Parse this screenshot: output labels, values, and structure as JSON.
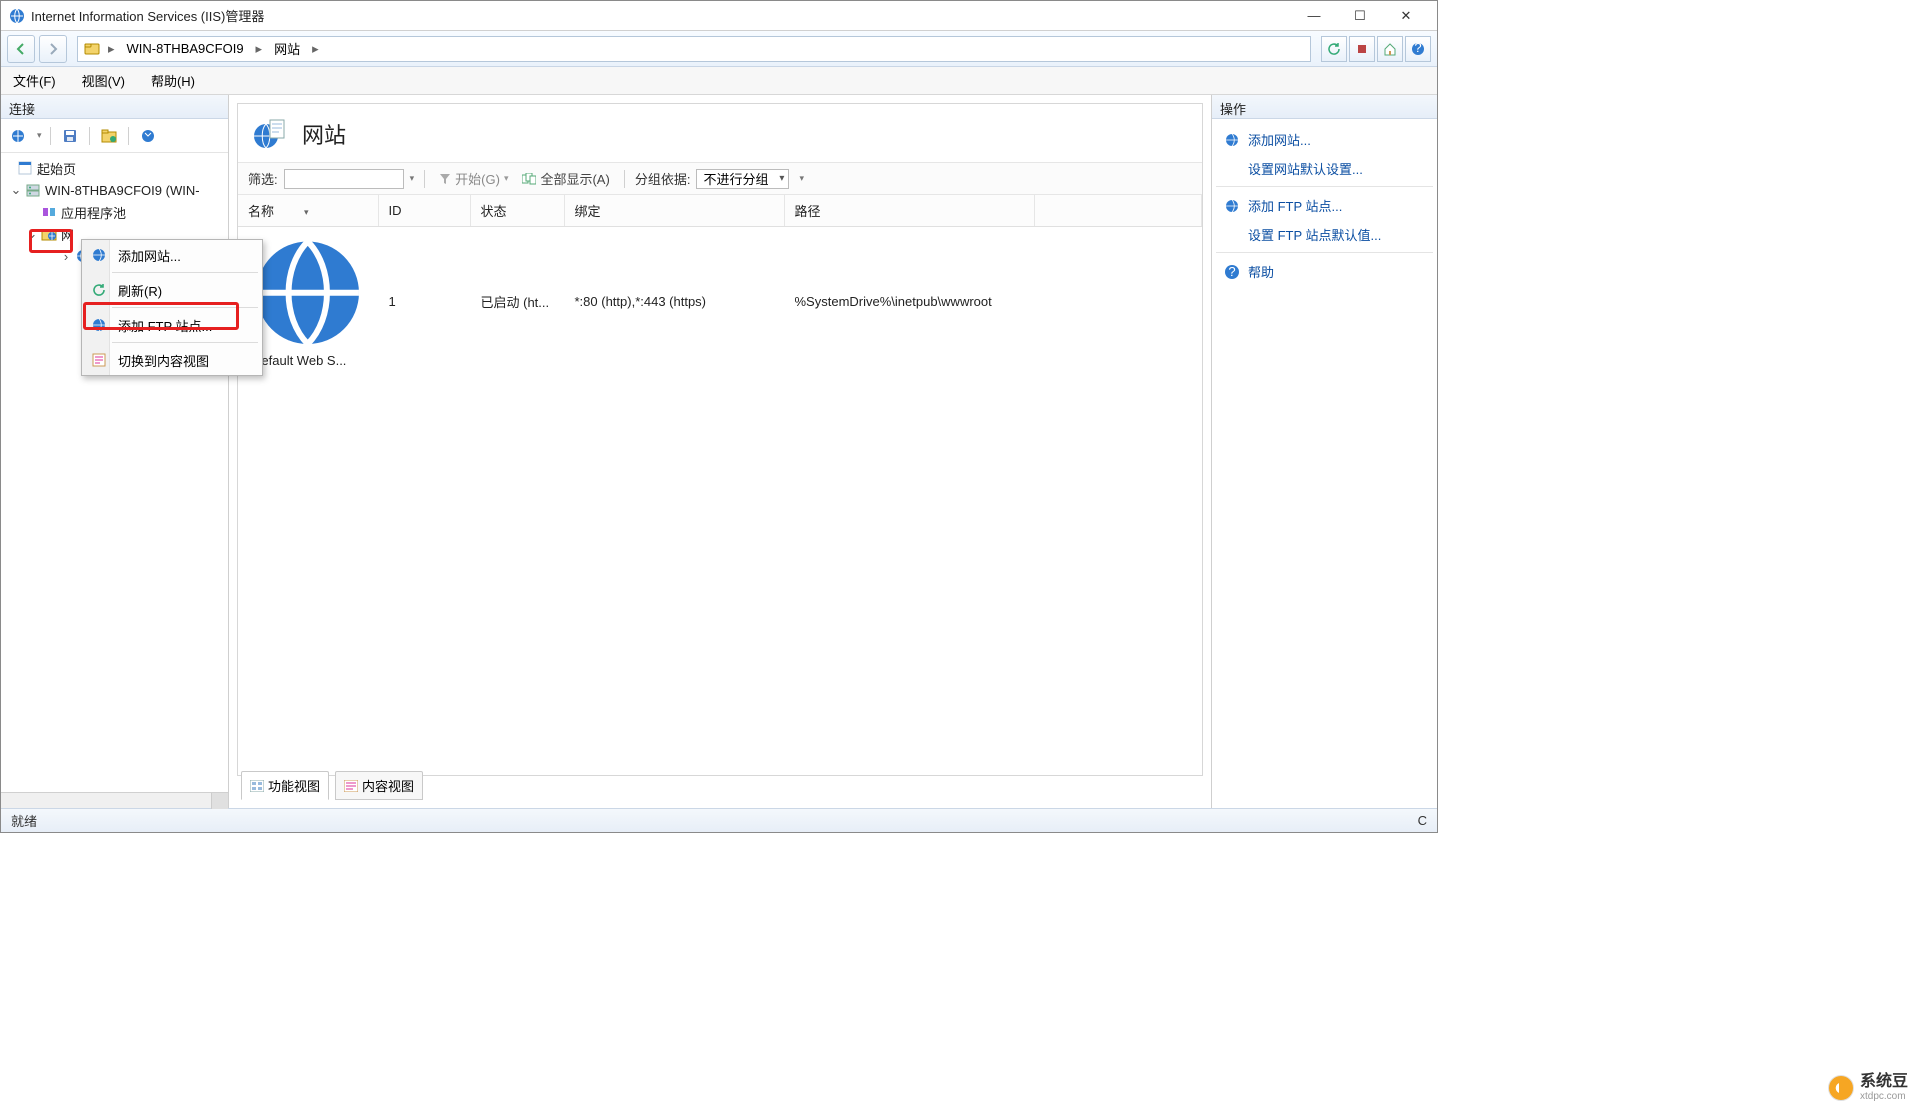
{
  "window": {
    "title": "Internet Information Services (IIS)管理器",
    "minimize": "—",
    "maximize": "☐",
    "close": "✕"
  },
  "breadcrumb": {
    "server": "WIN-8THBA9CFOI9",
    "node": "网站"
  },
  "menu": {
    "file": "文件(F)",
    "view": "视图(V)",
    "help": "帮助(H)"
  },
  "connections": {
    "header": "连接",
    "start_page": "起始页",
    "server": "WIN-8THBA9CFOI9 (WIN-",
    "app_pools": "应用程序池",
    "sites": "网"
  },
  "context_menu": {
    "add_site": "添加网站...",
    "refresh": "刷新(R)",
    "add_ftp": "添加 FTP 站点...",
    "content_view": "切换到内容视图"
  },
  "page": {
    "title": "网站"
  },
  "filter": {
    "label": "筛选:",
    "start": "开始(G)",
    "show_all": "全部显示(A)",
    "group_by": "分组依据:",
    "group_selected": "不进行分组"
  },
  "columns": {
    "name": "名称",
    "id": "ID",
    "status": "状态",
    "binding": "绑定",
    "path": "路径"
  },
  "rows": [
    {
      "name": "Default Web S...",
      "id": "1",
      "status": "已启动 (ht...",
      "binding": "*:80 (http),*:443 (https)",
      "path": "%SystemDrive%\\inetpub\\wwwroot"
    }
  ],
  "view_tabs": {
    "features": "功能视图",
    "content": "内容视图"
  },
  "actions": {
    "header": "操作",
    "add_site": "添加网站...",
    "site_defaults": "设置网站默认设置...",
    "add_ftp": "添加 FTP 站点...",
    "ftp_defaults": "设置 FTP 站点默认值...",
    "help": "帮助"
  },
  "status": {
    "ready": "就绪",
    "right": "C"
  },
  "watermark": {
    "main": "系统豆",
    "sub": "xtdpc.com"
  }
}
